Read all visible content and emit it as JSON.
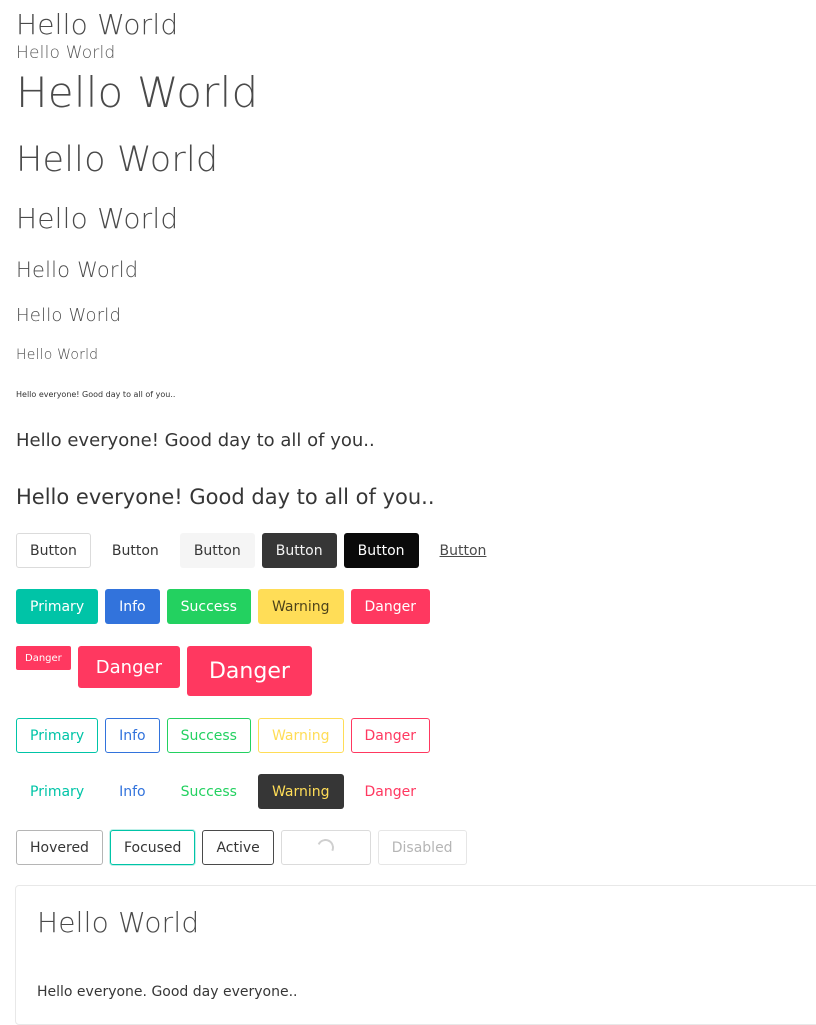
{
  "headings": [
    "Hello World",
    "Hello World",
    "Hello World",
    "Hello World",
    "Hello World",
    "Hello World",
    "Hello World",
    "Hello World"
  ],
  "paragraphs": {
    "tiny": "Hello everyone! Good day to all of you..",
    "medium": "Hello everyone! Good day to all of you..",
    "large": "Hello everyone! Good day to all of you.."
  },
  "basic_buttons": [
    "Button",
    "Button",
    "Button",
    "Button",
    "Button",
    "Button"
  ],
  "color_buttons": [
    "Primary",
    "Info",
    "Success",
    "Warning",
    "Danger"
  ],
  "size_buttons": [
    "Danger",
    "Danger",
    "Danger"
  ],
  "outlined_buttons": [
    "Primary",
    "Info",
    "Success",
    "Warning",
    "Danger"
  ],
  "text_buttons": [
    "Primary",
    "Info",
    "Success",
    "Warning",
    "Danger"
  ],
  "state_buttons": {
    "hovered": "Hovered",
    "focused": "Focused",
    "active": "Active",
    "disabled": "Disabled"
  },
  "card": {
    "title": "Hello World",
    "text": "Hello everyone. Good day everyone.."
  },
  "colors": {
    "primary": "#00c4a7",
    "info": "#3273dc",
    "success": "#23d160",
    "warning": "#ffdd57",
    "danger": "#ff3860",
    "dark": "#363636"
  }
}
